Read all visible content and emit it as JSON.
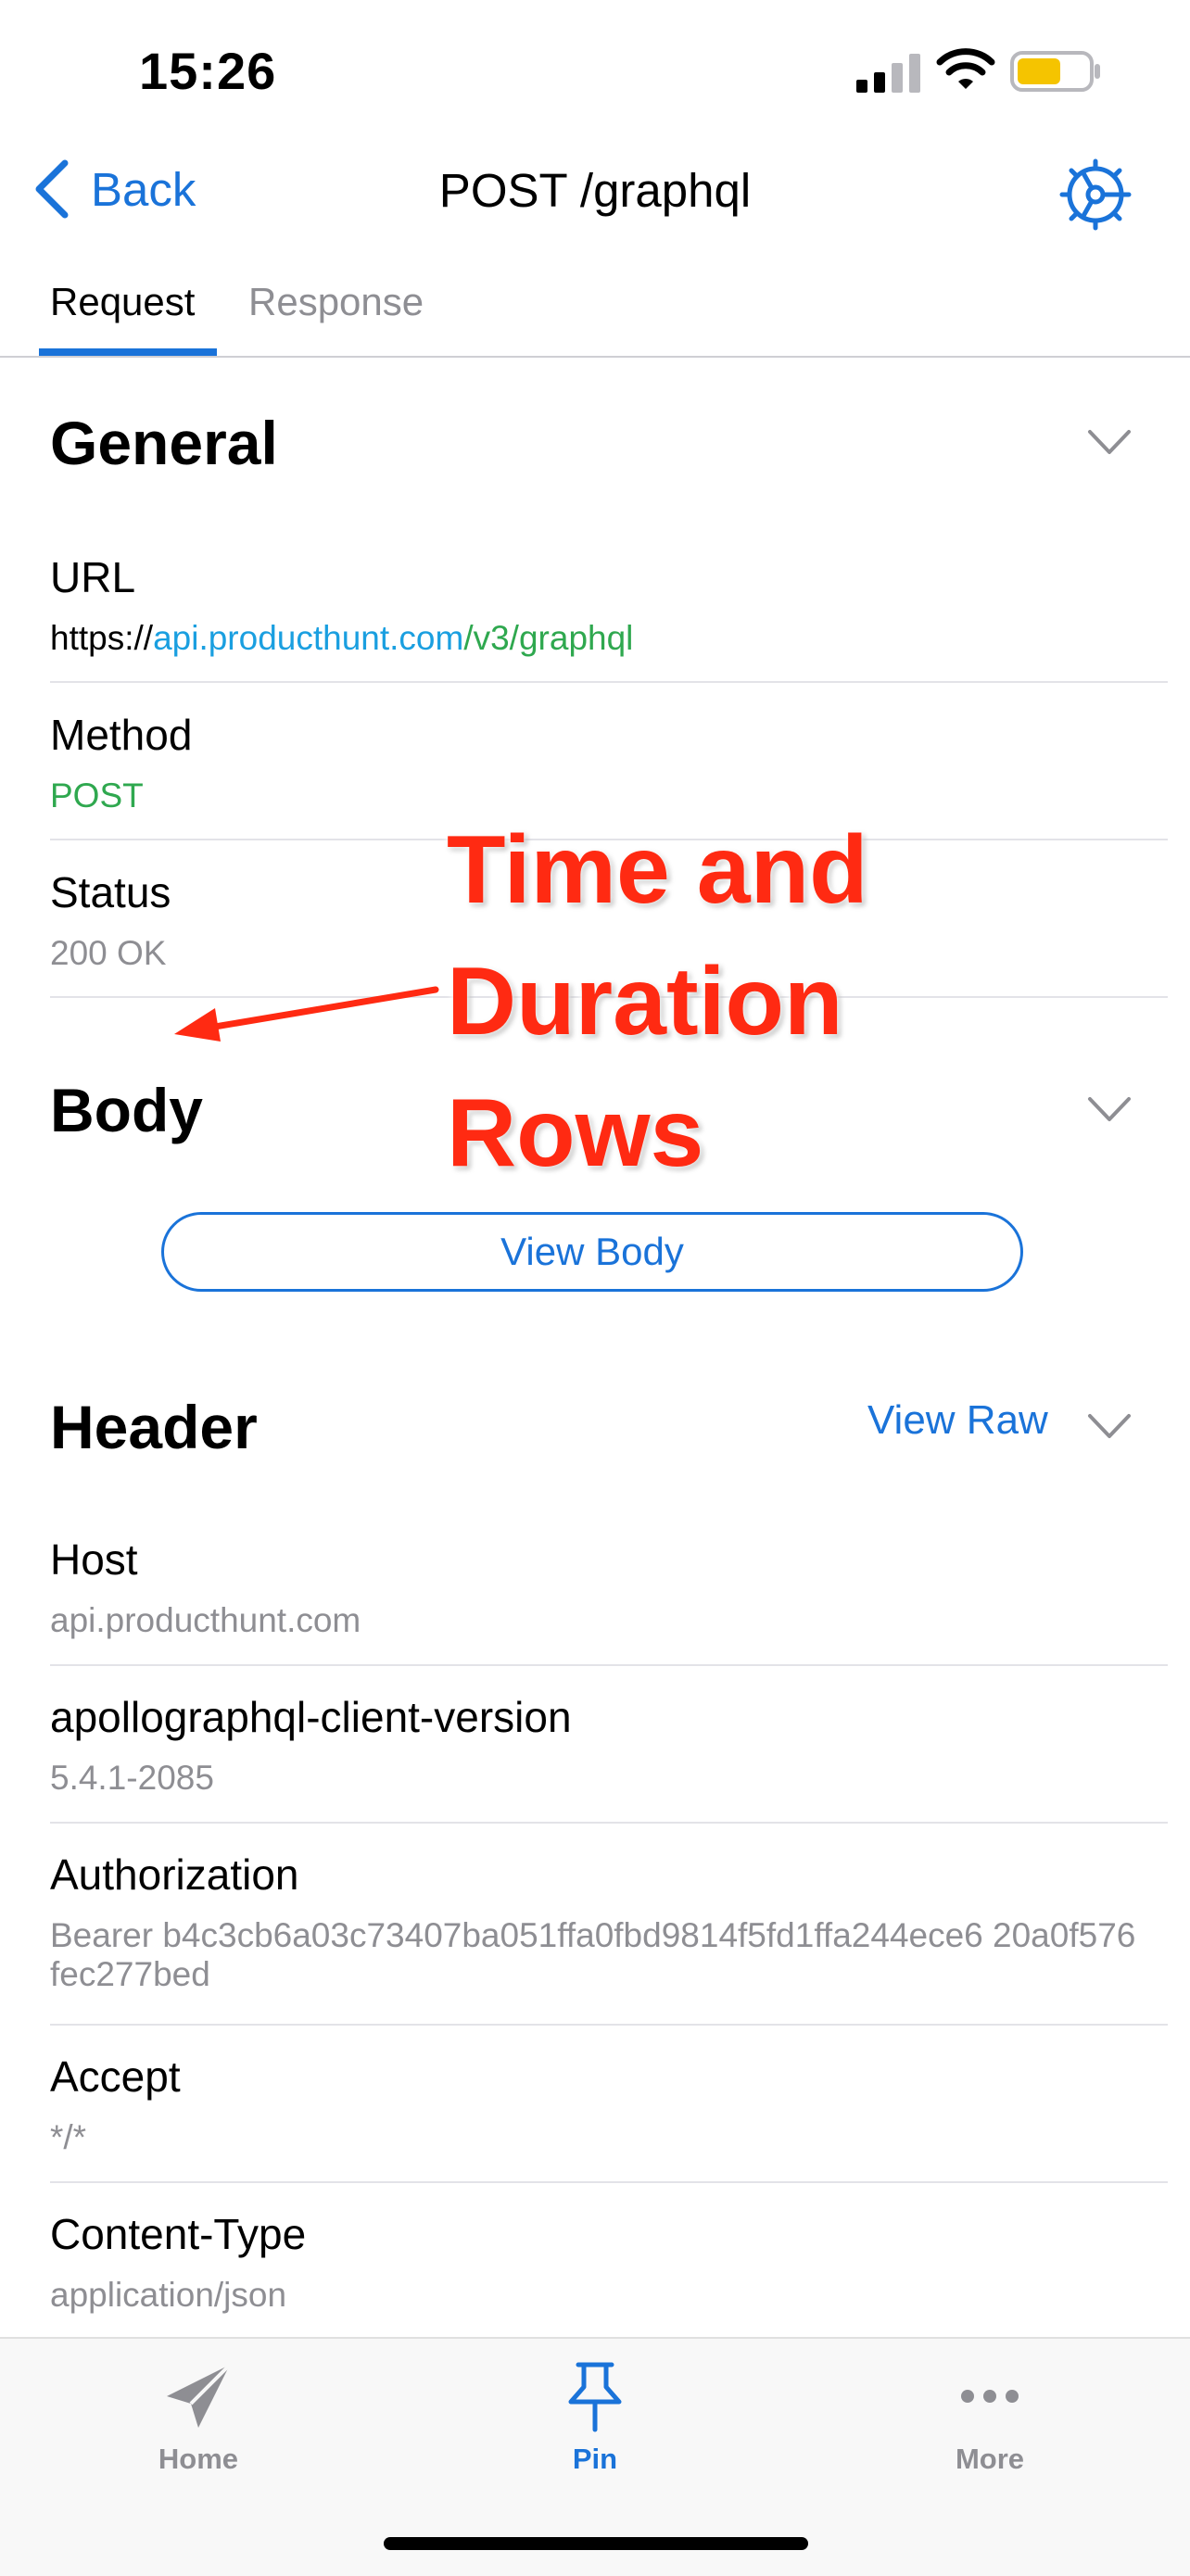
{
  "status_bar": {
    "time": "15:26"
  },
  "nav": {
    "back_label": "Back",
    "title": "POST /graphql"
  },
  "tabs": [
    {
      "label": "Request"
    },
    {
      "label": "Response"
    }
  ],
  "general": {
    "title": "General",
    "url_label": "URL",
    "url_scheme": "https://",
    "url_host": "api.producthunt.com",
    "url_path": "/v3/graphql",
    "method_label": "Method",
    "method_value": "POST",
    "status_label": "Status",
    "status_value": "200 OK"
  },
  "body": {
    "title": "Body",
    "view_body_label": "View Body"
  },
  "header": {
    "title": "Header",
    "view_raw_label": "View Raw",
    "rows": [
      {
        "label": "Host",
        "value": "api.producthunt.com"
      },
      {
        "label": "apollographql-client-version",
        "value": "5.4.1-2085"
      },
      {
        "label": "Authorization",
        "value": "Bearer b4c3cb6a03c73407ba051ffa0fbd9814f5fd1ffa244ece6 20a0f576fec277bed"
      },
      {
        "label": "Accept",
        "value": "*/*"
      },
      {
        "label": "Content-Type",
        "value": "application/json"
      }
    ]
  },
  "annotation": {
    "line1": "Time and",
    "line2": "Duration",
    "line3": "Rows"
  },
  "tab_bar": {
    "home": "Home",
    "pin": "Pin",
    "more": "More"
  },
  "colors": {
    "accent": "#1a73d9",
    "method_green": "#2fa84f",
    "url_host": "#1a9fe0",
    "annotation_red": "#ff2a12"
  }
}
